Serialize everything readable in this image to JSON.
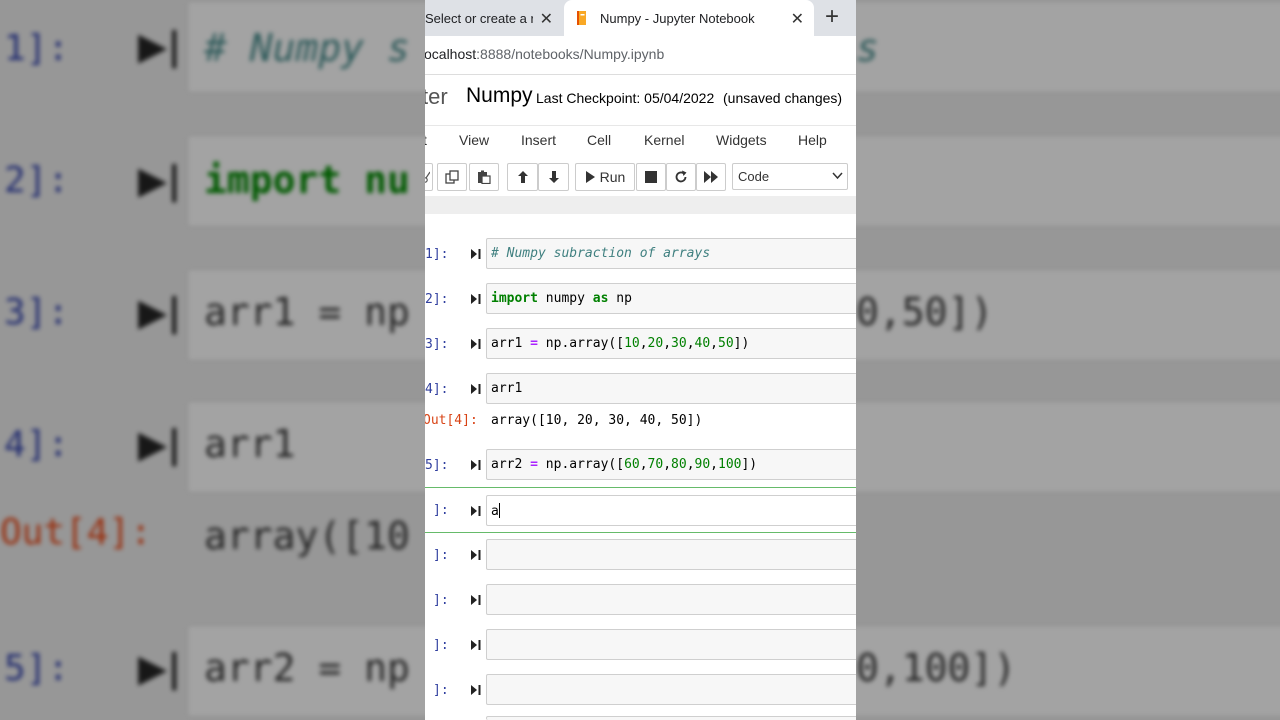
{
  "browser": {
    "tabs": [
      {
        "title": "Select or create a r",
        "active": false
      },
      {
        "title": "Numpy - Jupyter Notebook",
        "active": true
      }
    ],
    "close_glyph": "✕",
    "new_tab_glyph": "+",
    "url_host": "ocalhost",
    "url_path": ":8888/notebooks/Numpy.ipynb"
  },
  "jupyter": {
    "logo_text": "ter",
    "notebook_name": "Numpy",
    "checkpoint": "Last Checkpoint: 05/04/2022",
    "status": "(unsaved changes)",
    "menu": [
      "t",
      "View",
      "Insert",
      "Cell",
      "Kernel",
      "Widgets",
      "Help"
    ],
    "toolbar": {
      "run_label": "Run",
      "cell_type": "Code"
    }
  },
  "cells": [
    {
      "prompt": "1]:",
      "code": "# Numpy subraction of arrays"
    },
    {
      "prompt": "2]:",
      "code": "import numpy as np"
    },
    {
      "prompt": "3]:",
      "code": "arr1 = np.array([10,20,30,40,50])"
    },
    {
      "prompt": "4]:",
      "code": "arr1",
      "out_prompt": "Out[4]:",
      "output": "array([10, 20, 30, 40, 50])"
    },
    {
      "prompt": "5]:",
      "code": "arr2 = np.array([60,70,80,90,100])"
    },
    {
      "prompt": "]:",
      "code": "a"
    },
    {
      "prompt": "]:",
      "code": ""
    },
    {
      "prompt": "]:",
      "code": ""
    },
    {
      "prompt": "]:",
      "code": ""
    },
    {
      "prompt": "]:",
      "code": ""
    }
  ],
  "background": {
    "prompts": [
      "1]:",
      "2]:",
      "3]:",
      "4]:",
      "Out[4]:",
      "5]:"
    ],
    "code": [
      "# Numpy s",
      "import nu",
      "arr1 = np",
      "arr1",
      "array([10",
      "arr2 = np"
    ],
    "right_fragments": [
      "s",
      "0,50])",
      "0,100])"
    ]
  },
  "colors": {
    "prompt": "#303f9f",
    "out_prompt": "#d84315",
    "keyword": "#008000",
    "comment": "#408080",
    "selected_border": "#66bb6a"
  },
  "icons": [
    "jupyter-notebook-tab-icon",
    "cut-icon",
    "copy-icon",
    "paste-icon",
    "move-up-icon",
    "move-down-icon",
    "run-icon",
    "stop-icon",
    "restart-icon",
    "fast-forward-icon",
    "chevron-down-icon",
    "run-cell-icon"
  ]
}
